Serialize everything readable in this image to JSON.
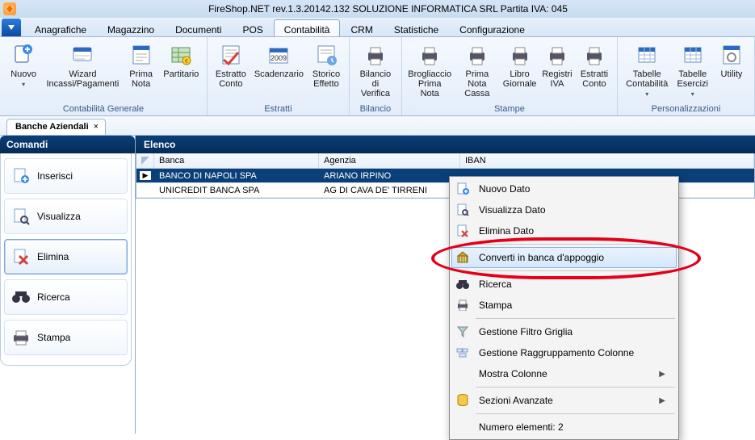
{
  "title": "FireShop.NET rev.1.3.20142.132 SOLUZIONE INFORMATICA SRL Partita IVA: 045",
  "menu": {
    "items": [
      "Anagrafiche",
      "Magazzino",
      "Documenti",
      "POS",
      "Contabilità",
      "CRM",
      "Statistiche",
      "Configurazione"
    ],
    "active_index": 4
  },
  "ribbon": {
    "groups": [
      {
        "caption": "Contabilità Generale",
        "buttons": [
          {
            "label": "Nuovo",
            "icon": "doc-plus",
            "drop": true
          },
          {
            "label": "Wizard\nIncassi/Pagamenti",
            "icon": "wizard"
          },
          {
            "label": "Prima\nNota",
            "icon": "note"
          },
          {
            "label": "Partitario",
            "icon": "ledger"
          }
        ]
      },
      {
        "caption": "Estratti",
        "buttons": [
          {
            "label": "Estratto\nConto",
            "icon": "statement"
          },
          {
            "label": "Scadenzario",
            "icon": "calendar"
          },
          {
            "label": "Storico\nEffetto",
            "icon": "history"
          }
        ]
      },
      {
        "caption": "Bilancio",
        "buttons": [
          {
            "label": "Bilancio\ndi Verifica",
            "icon": "printer"
          }
        ]
      },
      {
        "caption": "Stampe",
        "buttons": [
          {
            "label": "Brogliaccio\nPrima Nota",
            "icon": "printer"
          },
          {
            "label": "Prima Nota\nCassa",
            "icon": "printer"
          },
          {
            "label": "Libro\nGiornale",
            "icon": "printer"
          },
          {
            "label": "Registri\nIVA",
            "icon": "printer"
          },
          {
            "label": "Estratti\nConto",
            "icon": "printer"
          }
        ]
      },
      {
        "caption": "Personalizzazioni",
        "buttons": [
          {
            "label": "Tabelle\nContabilità",
            "icon": "table",
            "drop": true
          },
          {
            "label": "Tabelle\nEsercizi",
            "icon": "table",
            "drop": true
          },
          {
            "label": "Utility",
            "icon": "utility"
          }
        ]
      }
    ]
  },
  "doc_tab": {
    "label": "Banche Aziendali",
    "close": "×"
  },
  "left": {
    "header": "Comandi",
    "items": [
      {
        "label": "Inserisci",
        "icon": "plus-doc"
      },
      {
        "label": "Visualizza",
        "icon": "magnify-doc"
      },
      {
        "label": "Elimina",
        "icon": "delete-doc",
        "selected": true
      },
      {
        "label": "Ricerca",
        "icon": "binoculars"
      },
      {
        "label": "Stampa",
        "icon": "printer-small"
      }
    ]
  },
  "grid": {
    "header": "Elenco",
    "columns": [
      "Banca",
      "Agenzia",
      "IBAN"
    ],
    "rows": [
      {
        "banca": "BANCO DI NAPOLI SPA",
        "agenzia": "ARIANO IRPINO",
        "iban": "",
        "selected": true
      },
      {
        "banca": "UNICREDIT BANCA SPA",
        "agenzia": "AG DI CAVA DE' TIRRENI",
        "iban": ""
      }
    ]
  },
  "context_menu": {
    "items": [
      {
        "label": "Nuovo Dato",
        "icon": "doc-new"
      },
      {
        "label": "Visualizza Dato",
        "icon": "doc-view"
      },
      {
        "label": "Elimina Dato",
        "icon": "doc-del"
      },
      {
        "sep": true
      },
      {
        "label": "Converti in banca d'appoggio",
        "icon": "bank",
        "highlight": true
      },
      {
        "sep": true
      },
      {
        "label": "Ricerca",
        "icon": "binoc"
      },
      {
        "label": "Stampa",
        "icon": "printer-cm"
      },
      {
        "sep": true
      },
      {
        "label": "Gestione Filtro Griglia",
        "icon": "funnel"
      },
      {
        "label": "Gestione Raggruppamento Colonne",
        "icon": "group"
      },
      {
        "label": "Mostra Colonne",
        "submenu": true
      },
      {
        "sep": true
      },
      {
        "label": "Sezioni Avanzate",
        "icon": "db",
        "submenu": true
      },
      {
        "sep": true
      },
      {
        "label": "Numero elementi: 2"
      }
    ]
  }
}
